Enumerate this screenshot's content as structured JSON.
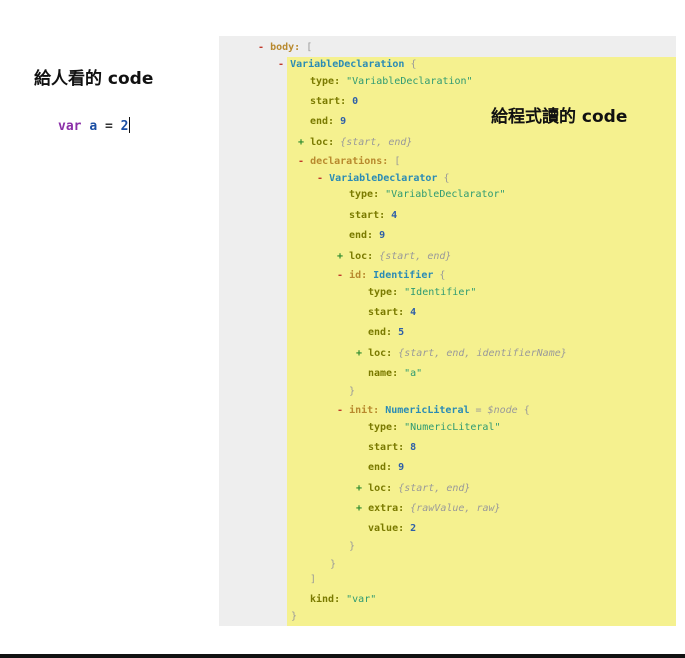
{
  "left": {
    "title": "給人看的 code",
    "code": {
      "keyword": "var",
      "identifier": "a",
      "operator": "=",
      "number": "2"
    }
  },
  "right": {
    "title": "給程式讀的 code"
  },
  "ast": {
    "body_key": "body:",
    "body_open": "[",
    "vdecl_name": "VariableDeclaration",
    "brace_open": "{",
    "brace_close": "}",
    "bracket_close": "]",
    "type_key": "type:",
    "start_key": "start:",
    "end_key": "end:",
    "loc_key": "loc:",
    "name_key": "name:",
    "value_key": "value:",
    "kind_key": "kind:",
    "id_key": "id:",
    "init_key": "init:",
    "extra_key": "extra:",
    "declarations_key": "declarations:",
    "minus": "-",
    "plus": "+",
    "vdecl_type": "\"VariableDeclaration\"",
    "vdecl_start": "0",
    "vdecl_end": "9",
    "loc_summary": "{start, end}",
    "declarator_name": "VariableDeclarator",
    "declarator_type": "\"VariableDeclarator\"",
    "declarator_start": "4",
    "declarator_end": "9",
    "identifier_name": "Identifier",
    "identifier_type": "\"Identifier\"",
    "identifier_start": "4",
    "identifier_end": "5",
    "identifier_loc_summary": "{start, end, identifierName}",
    "identifier_value": "\"a\"",
    "numeric_name": "NumericLiteral",
    "numeric_meta": "= $node",
    "numeric_type": "\"NumericLiteral\"",
    "numeric_start": "8",
    "numeric_end": "9",
    "extra_summary": "{rawValue, raw}",
    "numeric_value": "2",
    "kind_value": "\"var\""
  }
}
